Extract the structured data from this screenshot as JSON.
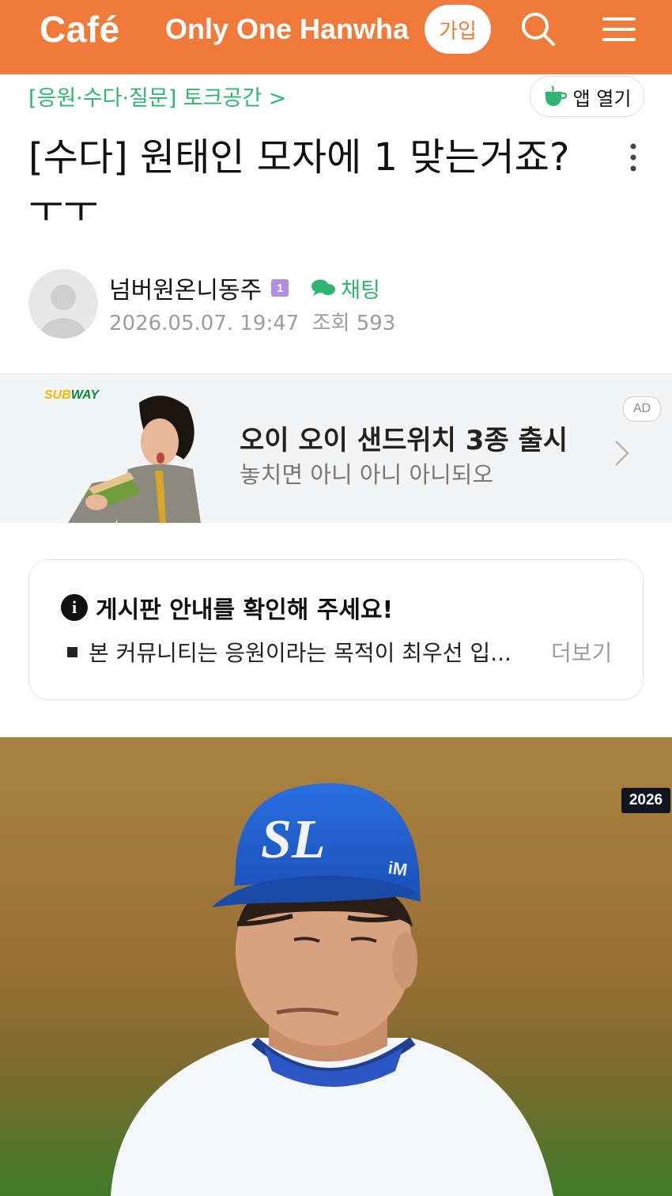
{
  "header": {
    "logo": "Café",
    "cafe_name": "Only One Hanwha",
    "join_label": "가입"
  },
  "board": {
    "breadcrumb": "[응원·수다·질문] 토크공간 >",
    "app_open_label": "앱 열기"
  },
  "post": {
    "title": "[수다] 원태인 모자에 1 맞는거죠? ㅜㅜ",
    "author": "넘버원온니동주",
    "level": "1",
    "chat_label": "채팅",
    "date": "2026.05.07. 19:47",
    "views_label": "조회",
    "views": "593"
  },
  "ad": {
    "brand": "SUBWAY",
    "title": "오이 오이 샌드위치 3종 출시",
    "subtitle": "놓치면 아니 아니 아니되오",
    "badge": "AD"
  },
  "notice": {
    "heading": "게시판 안내를 확인해 주세요!",
    "body": "본 커뮤니티는 응원이라는 목적이 최우선 입...",
    "more_label": "더보기"
  },
  "photo": {
    "cap_logo": "SL",
    "cap_side": "iM",
    "year_badge": "2026"
  },
  "colors": {
    "brand": "#f07a3a",
    "green": "#2fb56f",
    "cap_blue": "#1d5fd6"
  }
}
